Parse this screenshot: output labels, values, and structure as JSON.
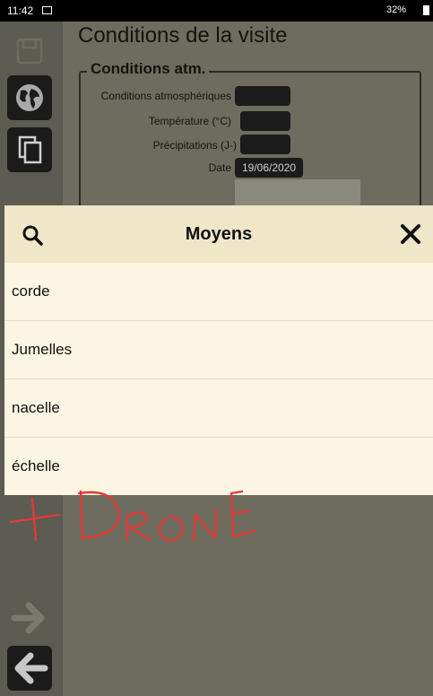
{
  "status_bar": {
    "time": "11:42",
    "signal": "‧‧‧",
    "battery_text": "32%"
  },
  "page": {
    "title": "Conditions de la visite"
  },
  "fieldset": {
    "legend": "Conditions atm.",
    "rows": [
      {
        "label": "Conditions atmosphériques"
      },
      {
        "label": "Température (°C)"
      },
      {
        "label": "Précipitations (J-)"
      },
      {
        "label": "Date",
        "value": "19/06/2020"
      }
    ]
  },
  "modal": {
    "title": "Moyens",
    "items": [
      "corde",
      "Jumelles",
      "nacelle",
      "échelle"
    ]
  },
  "annotation": {
    "text": "+ DRONE",
    "color": "#e53935"
  },
  "icons": {
    "search": "search-icon",
    "close": "close-icon",
    "globe": "globe-icon",
    "copy": "copy-icon",
    "save": "save-icon",
    "next": "arrow-right-icon",
    "back": "arrow-left-icon"
  }
}
